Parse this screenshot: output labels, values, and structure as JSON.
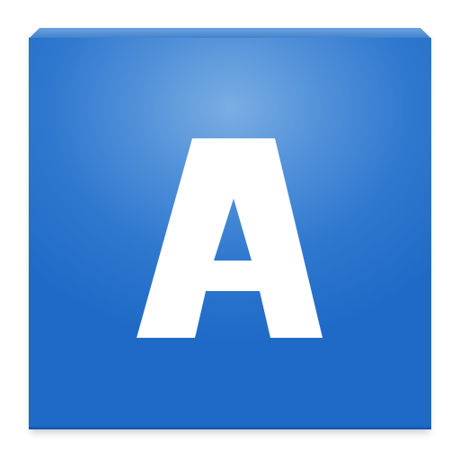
{
  "icon": {
    "letter": "A",
    "name": "letter-a-app-icon",
    "colors": {
      "face_light": "#7aaee3",
      "face_mid": "#2f78cf",
      "face_dark": "#1f6ac6",
      "top_edge_light": "#6ea3df",
      "top_edge_dark": "#3f7fc9",
      "glyph": "#ffffff"
    }
  }
}
